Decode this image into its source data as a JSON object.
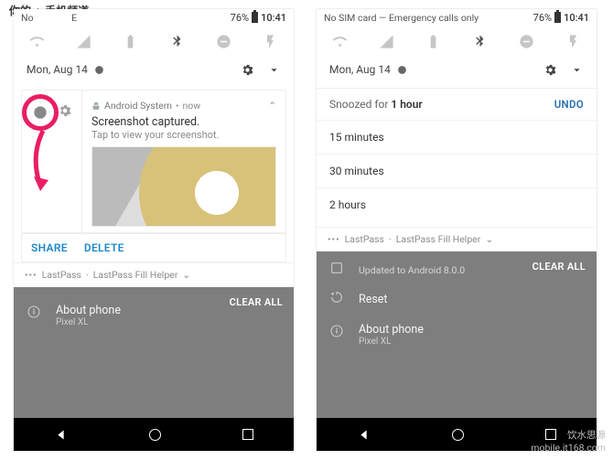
{
  "header": {
    "yours": "你的",
    "sep": "·",
    "cn": "手机频道"
  },
  "watermark": {
    "line1": "饮水思源",
    "line2": "mobile.it168.com"
  },
  "status": {
    "left_full": "No SIM card — Emergency calls only",
    "left_partial_a": "No",
    "left_partial_b": "E",
    "left_partial_c": "calls only",
    "battery": "76%",
    "time": "10:41"
  },
  "date": "Mon, Aug 14",
  "left_phone": {
    "notif": {
      "app": "Android System",
      "when": "now",
      "dot": "•",
      "title": "Screenshot captured.",
      "subtitle": "Tap to view your screenshot.",
      "share": "SHARE",
      "delete": "DELETE"
    },
    "lastpass": {
      "dots": "•••",
      "app": "LastPass",
      "helper": "LastPass Fill Helper",
      "sep": "·",
      "chev": "⌄"
    },
    "about": {
      "title": "About phone",
      "sub": "Pixel XL"
    },
    "clear_all": "CLEAR ALL"
  },
  "right_phone": {
    "snoozed_for": "Snoozed for",
    "snoozed_dur": "1 hour",
    "undo": "UNDO",
    "options": [
      "15 minutes",
      "30 minutes",
      "2 hours"
    ],
    "lastpass": {
      "dots": "•••",
      "app": "LastPass",
      "helper": "LastPass Fill Helper",
      "sep": "·",
      "chev": "⌄"
    },
    "updated": {
      "txt": "Updated to Android 8.0.0"
    },
    "reset": {
      "title": "Reset"
    },
    "about": {
      "title": "About phone",
      "sub": "Pixel XL"
    },
    "clear_all": "CLEAR ALL"
  }
}
